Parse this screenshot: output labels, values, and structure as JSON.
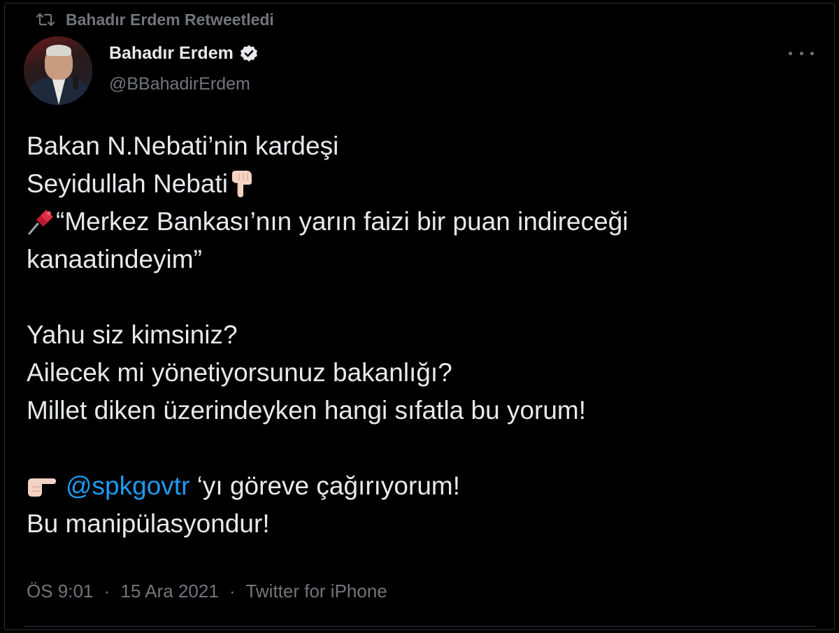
{
  "retweet": {
    "label": "Bahadır Erdem Retweetledi"
  },
  "author": {
    "name": "Bahadır Erdem",
    "handle": "@BBahadirErdem",
    "verified": true
  },
  "tweet": {
    "line1": "Bakan N.Nebati’nin kardeşi",
    "line2": "Seyidullah Nebati",
    "line3": "“Merkez Bankası’nın yarın faizi bir puan indireceği",
    "line4": "kanaatindeyim”",
    "line5": "Yahu siz kimsiniz?",
    "line6": "Ailecek mi yönetiyorsunuz bakanlığı?",
    "line7": "Millet diken üzerindeyken hangi sıfatla bu yorum!",
    "mention": "@spkgovtr",
    "line8_rest": " ‘yı göreve çağırıyorum!",
    "line9": "Bu manipülasyondur!",
    "emojis": {
      "pointing_down": "backhand-index-pointing-down-icon",
      "pushpin": "pushpin-icon",
      "pointing_right": "backhand-index-pointing-right-icon"
    }
  },
  "meta": {
    "time": "ÖS 9:01",
    "separator": "·",
    "date": "15 Ara 2021",
    "source": "Twitter for iPhone"
  },
  "colors": {
    "background": "#000000",
    "text": "#e7e9ea",
    "secondary": "#71767b",
    "link": "#1d9bf0",
    "divider": "#2f3336"
  }
}
